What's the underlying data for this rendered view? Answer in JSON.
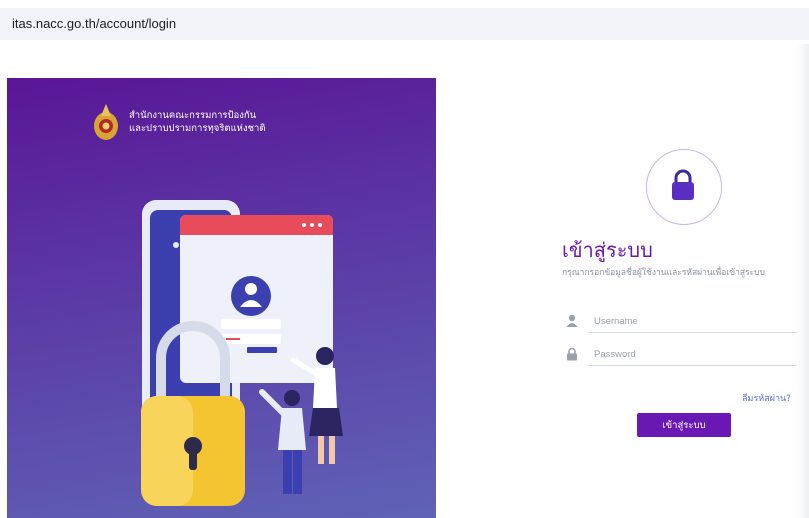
{
  "browser": {
    "url": "itas.nacc.go.th/account/login"
  },
  "organization": {
    "line1": "สำนักงานคณะกรรมการป้องกัน",
    "line2": "และปราบปรามการทุจริตแห่งชาติ",
    "emblem_icon": "nacc-emblem-icon"
  },
  "login": {
    "title": "เข้าสู่ระบบ",
    "subtitle": "กรุณากรอกข้อมูลชื่อผู้ใช้งานและรหัสผ่านเพื่อเข้าสู่ระบบ",
    "username_placeholder": "Username",
    "password_placeholder": "Password",
    "forgot_label": "ลืมรหัสผ่าน?",
    "submit_label": "เข้าสู่ระบบ",
    "lock_icon": "lock-icon",
    "user_icon": "user-icon",
    "password_icon": "padlock-icon"
  },
  "colors": {
    "accent": "#6a18b4",
    "hero_top": "#5a1696",
    "hero_bottom": "#5f63b6",
    "link": "#5a6fd0"
  }
}
